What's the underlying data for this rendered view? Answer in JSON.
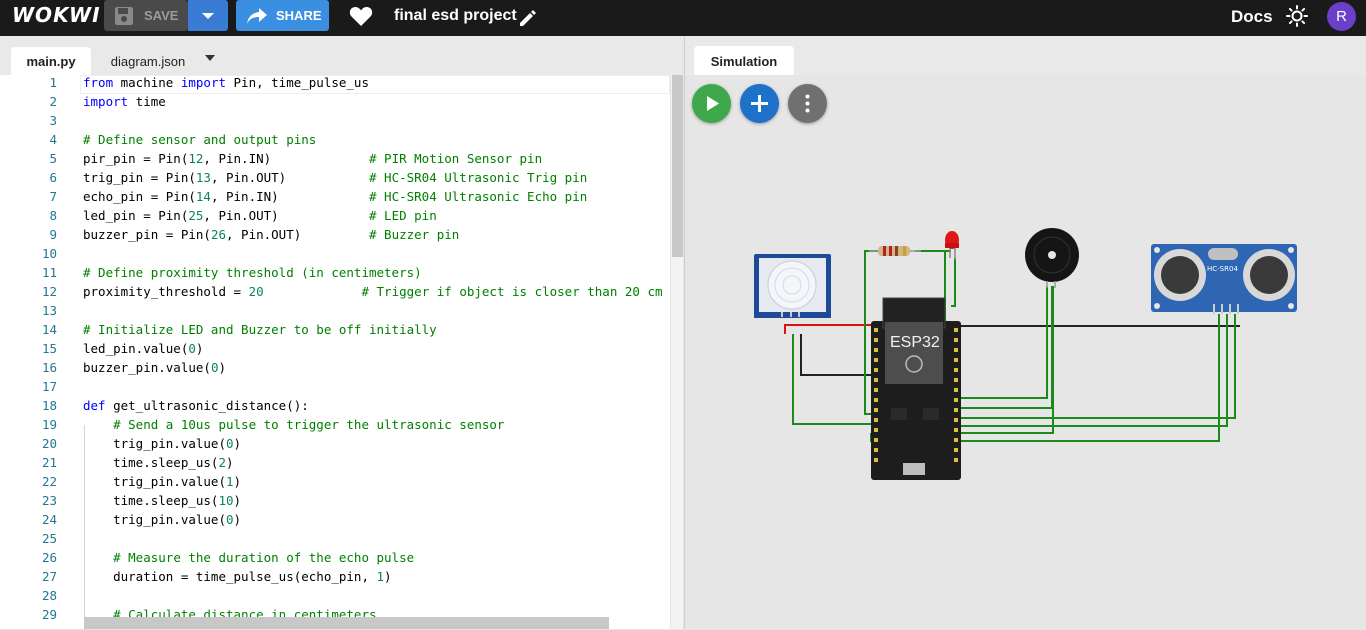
{
  "header": {
    "logo": "WOKWI",
    "save_label": "SAVE",
    "share_label": "SHARE",
    "project_title": "final esd project",
    "docs_label": "Docs",
    "avatar_letter": "R"
  },
  "editor": {
    "tabs": [
      {
        "label": "main.py",
        "active": true
      },
      {
        "label": "diagram.json",
        "active": false
      }
    ],
    "lines": [
      {
        "n": "1",
        "html": "<span class=\"kw\">from</span> machine <span class=\"kw\">import</span> Pin, time_pulse_us"
      },
      {
        "n": "2",
        "html": "<span class=\"kw\">import</span> time"
      },
      {
        "n": "3",
        "html": ""
      },
      {
        "n": "4",
        "html": "<span class=\"cm\"># Define sensor and output pins</span>"
      },
      {
        "n": "5",
        "html": "pir_pin = Pin(<span class=\"nm\">12</span>, Pin.IN)             <span class=\"cm\"># PIR Motion Sensor pin</span>"
      },
      {
        "n": "6",
        "html": "trig_pin = Pin(<span class=\"nm\">13</span>, Pin.OUT)           <span class=\"cm\"># HC-SR04 Ultrasonic Trig pin</span>"
      },
      {
        "n": "7",
        "html": "echo_pin = Pin(<span class=\"nm\">14</span>, Pin.IN)            <span class=\"cm\"># HC-SR04 Ultrasonic Echo pin</span>"
      },
      {
        "n": "8",
        "html": "led_pin = Pin(<span class=\"nm\">25</span>, Pin.OUT)            <span class=\"cm\"># LED pin</span>"
      },
      {
        "n": "9",
        "html": "buzzer_pin = Pin(<span class=\"nm\">26</span>, Pin.OUT)         <span class=\"cm\"># Buzzer pin</span>"
      },
      {
        "n": "10",
        "html": ""
      },
      {
        "n": "11",
        "html": "<span class=\"cm\"># Define proximity threshold (in centimeters)</span>"
      },
      {
        "n": "12",
        "html": "proximity_threshold = <span class=\"nm\">20</span>             <span class=\"cm\"># Trigger if object is closer than 20 cm</span>"
      },
      {
        "n": "13",
        "html": ""
      },
      {
        "n": "14",
        "html": "<span class=\"cm\"># Initialize LED and Buzzer to be off initially</span>"
      },
      {
        "n": "15",
        "html": "led_pin.value(<span class=\"nm\">0</span>)"
      },
      {
        "n": "16",
        "html": "buzzer_pin.value(<span class=\"nm\">0</span>)"
      },
      {
        "n": "17",
        "html": ""
      },
      {
        "n": "18",
        "html": "<span class=\"kw\">def</span> get_ultrasonic_distance():"
      },
      {
        "n": "19",
        "html": "    <span class=\"cm\"># Send a 10us pulse to trigger the ultrasonic sensor</span>"
      },
      {
        "n": "20",
        "html": "    trig_pin.value(<span class=\"nm\">0</span>)"
      },
      {
        "n": "21",
        "html": "    time.sleep_us(<span class=\"nm\">2</span>)"
      },
      {
        "n": "22",
        "html": "    trig_pin.value(<span class=\"nm\">1</span>)"
      },
      {
        "n": "23",
        "html": "    time.sleep_us(<span class=\"nm\">10</span>)"
      },
      {
        "n": "24",
        "html": "    trig_pin.value(<span class=\"nm\">0</span>)"
      },
      {
        "n": "25",
        "html": ""
      },
      {
        "n": "26",
        "html": "    <span class=\"cm\"># Measure the duration of the echo pulse</span>"
      },
      {
        "n": "27",
        "html": "    duration = time_pulse_us(echo_pin, <span class=\"nm\">1</span>)"
      },
      {
        "n": "28",
        "html": ""
      },
      {
        "n": "29",
        "html": "    <span class=\"cm\"># Calculate distance in centimeters</span>"
      }
    ]
  },
  "simulation": {
    "tab_label": "Simulation",
    "esp32_label": "ESP32",
    "ultrasonic_label": "HC-SR04",
    "controls": [
      "play",
      "add-part",
      "more-options"
    ]
  },
  "colors": {
    "topbar": "#1a1a1a",
    "share": "#3a8fe0",
    "play": "#3ea84a",
    "add": "#1d71c9",
    "wire_green": "#1a8a1a",
    "wire_red": "#e01010"
  }
}
